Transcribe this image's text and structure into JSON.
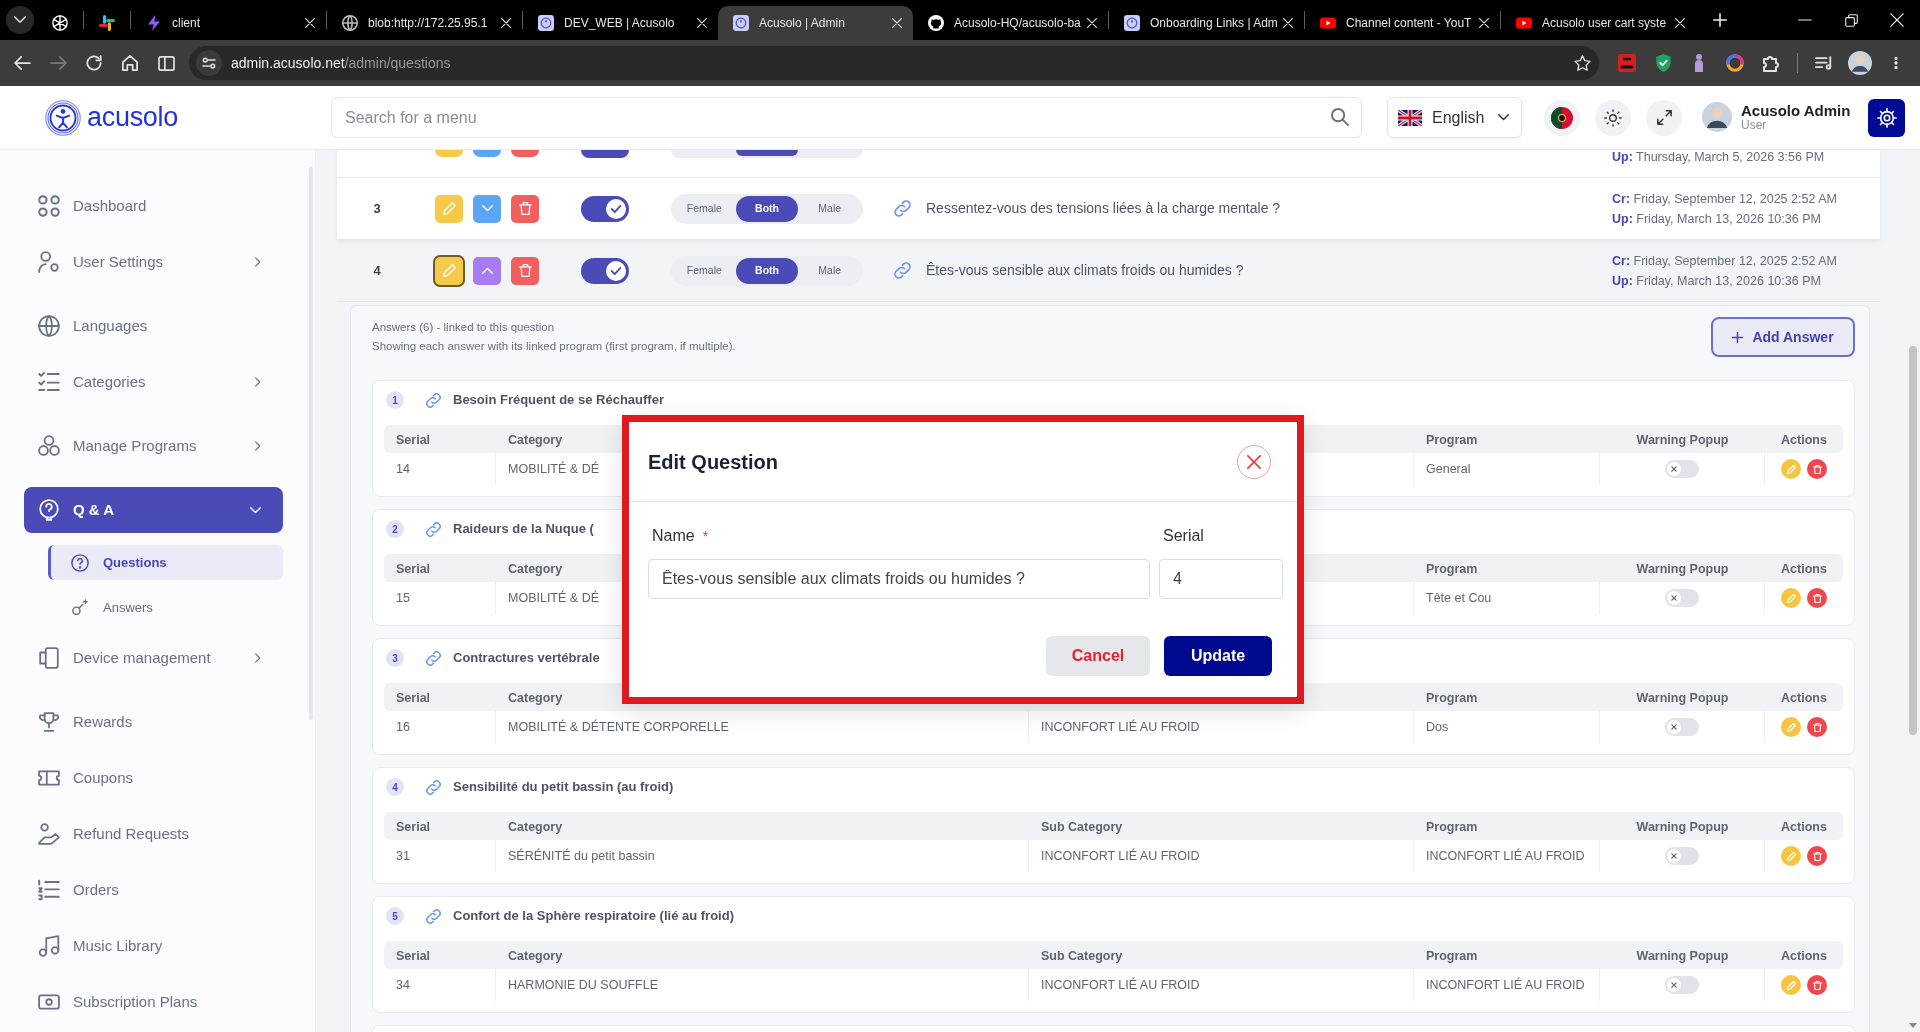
{
  "browser": {
    "tabs": [
      {
        "kind": "pinned",
        "selected": false
      },
      {
        "kind": "pinned",
        "selected": false
      },
      {
        "kind": "page",
        "title": "client",
        "selected": false
      },
      {
        "kind": "page",
        "title": "blob:http://172.25.95.1",
        "selected": false
      },
      {
        "kind": "page",
        "title": "DEV_WEB | Acusolo",
        "selected": false
      },
      {
        "kind": "page",
        "title": "Acusolo | Admin",
        "selected": true
      },
      {
        "kind": "page",
        "title": "Acusolo-HQ/acusolo-ba",
        "selected": false
      },
      {
        "kind": "page",
        "title": "Onboarding Links | Adm",
        "selected": false
      },
      {
        "kind": "page",
        "title": "Channel content - YouT",
        "selected": false
      },
      {
        "kind": "page",
        "title": "Acusolo user cart syste",
        "selected": false
      }
    ],
    "forward_disabled": true,
    "address": {
      "host": "admin.acusolo.net",
      "path": "/admin/questions"
    }
  },
  "header": {
    "logo": "acusolo",
    "search": {
      "placeholder": "Search for a menu"
    },
    "language": "English",
    "user": {
      "name": "Acusolo Admin",
      "role": "User"
    }
  },
  "sidebar": {
    "items": [
      {
        "label": "Dashboard",
        "kind": "link",
        "selected": false
      },
      {
        "label": "User Settings",
        "kind": "group",
        "expanded": false,
        "selected": false
      },
      {
        "label": "Languages",
        "kind": "link",
        "selected": false
      },
      {
        "label": "Categories",
        "kind": "group",
        "expanded": false,
        "selected": false
      },
      {
        "label": "Manage Programs",
        "kind": "group",
        "expanded": false,
        "selected": false
      },
      {
        "label": "Q & A",
        "kind": "group",
        "expanded": true,
        "selected": true,
        "children": [
          {
            "label": "Questions",
            "selected": true
          },
          {
            "label": "Answers",
            "selected": false
          }
        ]
      },
      {
        "label": "Device management",
        "kind": "group",
        "expanded": false,
        "selected": false
      },
      {
        "label": "Rewards",
        "kind": "link",
        "selected": false
      },
      {
        "label": "Coupons",
        "kind": "link",
        "selected": false
      },
      {
        "label": "Refund Requests",
        "kind": "link",
        "selected": false
      },
      {
        "label": "Orders",
        "kind": "link",
        "selected": false
      },
      {
        "label": "Music Library",
        "kind": "link",
        "selected": false
      },
      {
        "label": "Subscription Plans",
        "kind": "link",
        "selected": false
      }
    ]
  },
  "questions": {
    "rows": [
      {
        "kind": "clipped",
        "hovered": true,
        "active": true,
        "expanded": false,
        "gender": [
          {
            "selected": false
          },
          {
            "selected": true
          },
          {
            "selected": false
          }
        ],
        "updated_label": "Up:",
        "updated": "Thursday, March 5, 2026 3:56 PM"
      },
      {
        "kind": "full",
        "serial": "3",
        "hovered": true,
        "edit_focused": false,
        "expanded": false,
        "active": true,
        "gender": [
          {
            "label": "Female",
            "selected": false
          },
          {
            "label": "Both",
            "selected": true
          },
          {
            "label": "Male",
            "selected": false
          }
        ],
        "question": "Ressentez-vous des tensions liées à la charge mentale ?",
        "created_label": "Cr:",
        "created": "Friday, September 12, 2025 2:52 AM",
        "updated_label": "Up:",
        "updated": "Friday, March 13, 2026 10:36 PM"
      },
      {
        "kind": "full",
        "serial": "4",
        "hovered": false,
        "edit_focused": true,
        "expanded": true,
        "active": true,
        "gender": [
          {
            "label": "Female",
            "selected": false
          },
          {
            "label": "Both",
            "selected": true
          },
          {
            "label": "Male",
            "selected": false
          }
        ],
        "question": "Êtes-vous sensible aux climats froids ou humides ?",
        "created_label": "Cr:",
        "created": "Friday, September 12, 2025 2:52 AM",
        "updated_label": "Up:",
        "updated": "Friday, March 13, 2026 10:36 PM",
        "answers": {
          "summary": "Answers (6) - linked to this question",
          "note": "Showing each answer with its linked program (first program, if multiple).",
          "add_label": "Add Answer",
          "items": [
            {
              "kind": "full",
              "number": "1",
              "title": "Besoin Fréquent de se Réchauffer",
              "header": {
                "serial": "Serial",
                "category": "Category",
                "program": "Program",
                "warning_popup": "Warning Popup",
                "actions": "Actions"
              },
              "row": {
                "serial": "14",
                "category": "MOBILITÉ & DÉ",
                "program": "General",
                "warning_popup": false
              }
            },
            {
              "kind": "full",
              "number": "2",
              "title": "Raideurs de la Nuque (",
              "header": {
                "serial": "Serial",
                "category": "Category",
                "program": "Program",
                "warning_popup": "Warning Popup",
                "actions": "Actions"
              },
              "row": {
                "serial": "15",
                "category": "MOBILITÉ & DÉ",
                "program": "Tête et Cou",
                "warning_popup": false
              }
            },
            {
              "kind": "full",
              "number": "3",
              "title": "Contractures vertébrale",
              "header": {
                "serial": "Serial",
                "category": "Category",
                "program": "Program",
                "warning_popup": "Warning Popup",
                "actions": "Actions"
              },
              "row": {
                "serial": "16",
                "category": "MOBILITÉ & DÉTENTE CORPORELLE",
                "sub_category": "INCONFORT LIÉ AU FROID",
                "program": "Dos",
                "warning_popup": false
              }
            },
            {
              "kind": "full",
              "number": "4",
              "title": "Sensibilité du petit bassin (au froid)",
              "header": {
                "serial": "Serial",
                "category": "Category",
                "sub_category": "Sub Category",
                "program": "Program",
                "warning_popup": "Warning Popup",
                "actions": "Actions"
              },
              "row": {
                "serial": "31",
                "category": "SÉRÉNITÉ du petit bassin",
                "sub_category": "INCONFORT LIÉ AU FROID",
                "program": "INCONFORT LIÉ AU FROID",
                "warning_popup": false
              }
            },
            {
              "kind": "full",
              "number": "5",
              "title": "Confort de la Sphère respiratoire (lié au froid)",
              "header": {
                "serial": "Serial",
                "category": "Category",
                "sub_category": "Sub Category",
                "program": "Program",
                "warning_popup": "Warning Popup",
                "actions": "Actions"
              },
              "row": {
                "serial": "34",
                "category": "HARMONIE DU SOUFFLE",
                "sub_category": "INCONFORT LIÉ AU FROID",
                "program": "INCONFORT LIÉ AU FROID",
                "warning_popup": false
              }
            },
            {
              "kind": "clipped"
            }
          ]
        }
      }
    ]
  },
  "dialog": {
    "title": "Edit Question",
    "highlighted": true,
    "fields": [
      {
        "label": "Name",
        "required_mark": "*",
        "value": "Êtes-vous sensible aux climats froids ou humides ?"
      },
      {
        "label": "Serial",
        "value": "4"
      }
    ],
    "buttons": [
      {
        "label": "Cancel",
        "kind": "secondary"
      },
      {
        "label": "Update",
        "kind": "primary"
      }
    ]
  }
}
